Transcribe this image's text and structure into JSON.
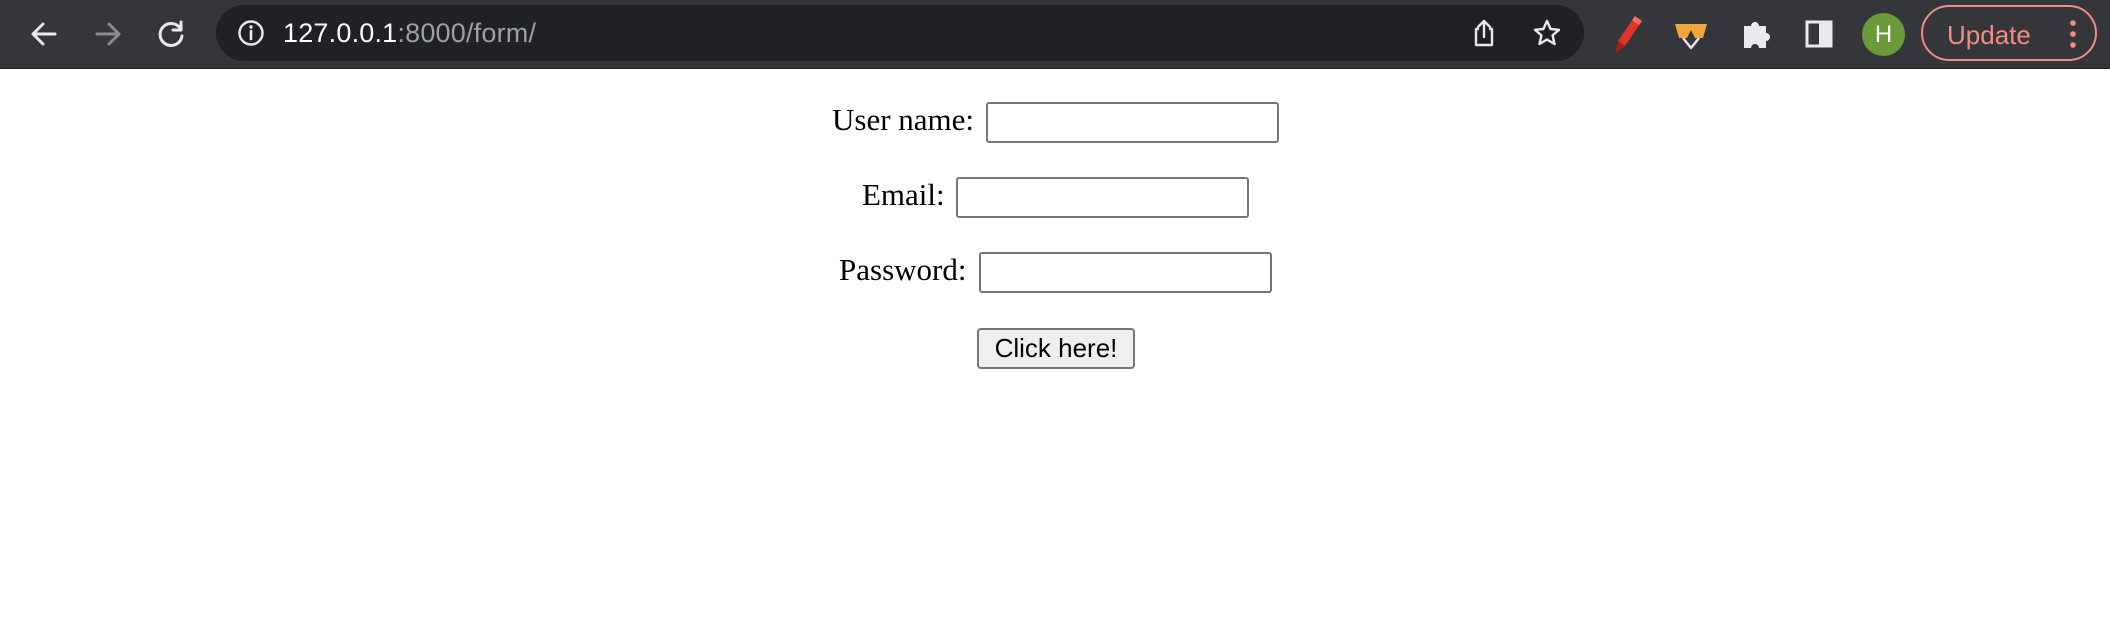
{
  "browser": {
    "url_host": "127.0.0.1",
    "url_rest": ":8000/form/",
    "profile_initial": "H",
    "update_label": "Update",
    "icons": {
      "back": "back-arrow-icon",
      "forward": "forward-arrow-icon",
      "reload": "reload-icon",
      "site_info": "info-icon",
      "share": "share-icon",
      "bookmark": "star-icon",
      "ext_marker": "marker-extension-icon",
      "ext_glasses": "glasses-extension-icon",
      "extensions": "puzzle-icon",
      "side_panel": "side-panel-icon",
      "menu": "kebab-menu-icon"
    },
    "colors": {
      "toolbar": "#35363a",
      "omnibox": "#202124",
      "update_accent": "#f28b82",
      "avatar": "#6a9a3a"
    }
  },
  "form": {
    "username_label": "User name:",
    "username_value": "",
    "email_label": "Email:",
    "email_value": "",
    "password_label": "Password:",
    "password_value": "",
    "submit_label": "Click here!"
  }
}
